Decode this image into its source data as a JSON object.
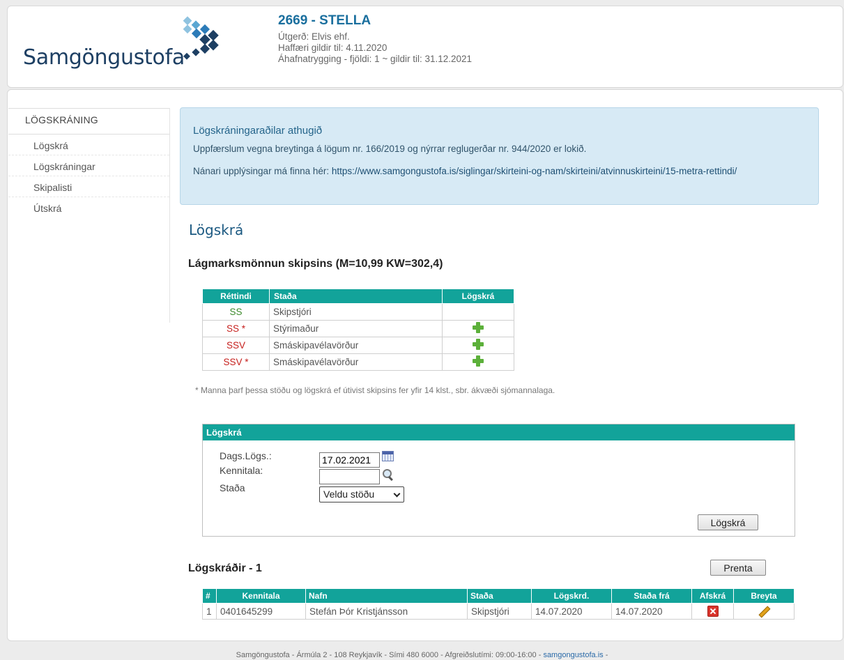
{
  "header": {
    "logo_text": "Samgöngustofa",
    "ship_title": "2669 - STELLA",
    "lines": [
      "Útgerð: Elvis ehf.",
      "Haffæri gildir til: 4.11.2020",
      "Áhafnatrygging - fjöldi: 1 ~ gildir til: 31.12.2021"
    ]
  },
  "sidebar": {
    "title": "LÖGSKRÁNING",
    "items": [
      "Lögskrá",
      "Lögskráningar",
      "Skipalisti",
      "Útskrá"
    ]
  },
  "notice": {
    "title": "Lögskráningaraðilar athugið",
    "line1": "Uppfærslum vegna breytinga á lögum nr. 166/2019 og nýrrar reglugerðar nr. 944/2020 er lokið.",
    "line2_prefix": "Nánari upplýsingar má finna hér: ",
    "line2_link": "https://www.samgongustofa.is/siglingar/skirteini-og-nam/skirteini/atvinnuskirteini/15-metra-rettindi/"
  },
  "page_heading": "Lögskrá",
  "min_heading": "Lágmarksmönnun skipsins (M=10,99 KW=302,4)",
  "req_table": {
    "headers": [
      "Réttindi",
      "Staða",
      "Lögskrá"
    ],
    "rows": [
      {
        "code": "SS",
        "role": "Skipstjóri",
        "color": "#3c8a2a",
        "add": false
      },
      {
        "code": "SS *",
        "role": "Stýrimaður",
        "color": "#c6201d",
        "add": true
      },
      {
        "code": "SSV",
        "role": "Smáskipavélavörður",
        "color": "#c6201d",
        "add": true
      },
      {
        "code": "SSV *",
        "role": "Smáskipavélavörður",
        "color": "#c6201d",
        "add": true
      }
    ]
  },
  "footnote": "* Manna þarf þessa stöðu og lögskrá ef útivist skipsins fer yfir 14 klst., sbr. ákvæði sjómannalaga.",
  "form": {
    "title": "Lögskrá",
    "date_label": "Dags.Lögs.:",
    "date_value": "17.02.2021",
    "kennitala_label": "Kennitala:",
    "kennitala_value": "",
    "stada_label": "Staða",
    "stada_selected": "Veldu stöðu",
    "submit_label": "Lögskrá"
  },
  "list": {
    "heading": "Lögskráðir - 1",
    "print_label": "Prenta",
    "headers": [
      "#",
      "Kennitala",
      "Nafn",
      "Staða",
      "Lögskrd.",
      "Staða frá",
      "Afskrá",
      "Breyta"
    ],
    "rows": [
      {
        "num": "1",
        "kennitala": "0401645299",
        "name": "Stefán Þór Kristjánsson",
        "stada": "Skipstjóri",
        "logskrd": "14.07.2020",
        "stada_fra": "14.07.2020"
      }
    ]
  },
  "footer": {
    "text": "Samgöngustofa - Ármúla 2 - 108 Reykjavík - Sími 480 6000 - Afgreiðslutími: 09:00-16:00 - ",
    "link": "samgongustofa.is",
    "suffix": " -"
  }
}
